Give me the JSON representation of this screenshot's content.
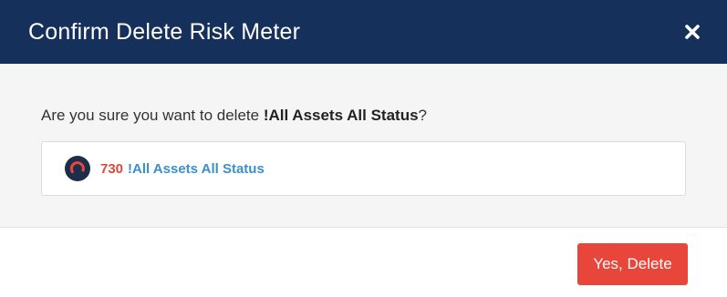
{
  "header": {
    "title": "Confirm Delete Risk Meter"
  },
  "body": {
    "prompt_prefix": "Are you sure you want to delete ",
    "prompt_target": "!All Assets All Status",
    "prompt_suffix": "?",
    "meter": {
      "score": "730",
      "name": "!All Assets All Status",
      "icon": "risk-gauge-icon"
    }
  },
  "footer": {
    "confirm_label": "Yes, Delete"
  },
  "colors": {
    "header_bg": "#15305a",
    "danger": "#e8463a",
    "score": "#e0463a",
    "link": "#3a90c9"
  }
}
